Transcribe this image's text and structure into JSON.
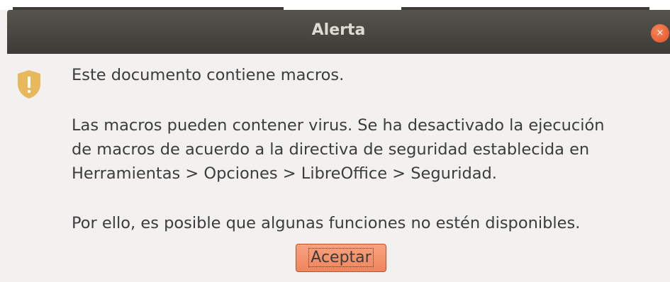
{
  "window": {
    "title": "Alerta",
    "close_icon": "close-icon",
    "close_glyph": "×"
  },
  "dialog": {
    "icon": "shield-warning-icon",
    "heading": "Este documento contiene macros.",
    "detail": "Las macros pueden contener virus. Se ha desactivado la ejecución\nde macros de acuerdo a la directiva de seguridad establecida en\nHerramientas > Opciones > LibreOffice > Seguridad.",
    "note": "Por ello, es posible que algunas funciones no estén disponibles.",
    "ok_label": "Aceptar"
  },
  "colors": {
    "titlebar": "#3c3b37",
    "close_button": "#e95420",
    "accent_button": "#f08b63",
    "icon": "#e8b95c"
  }
}
